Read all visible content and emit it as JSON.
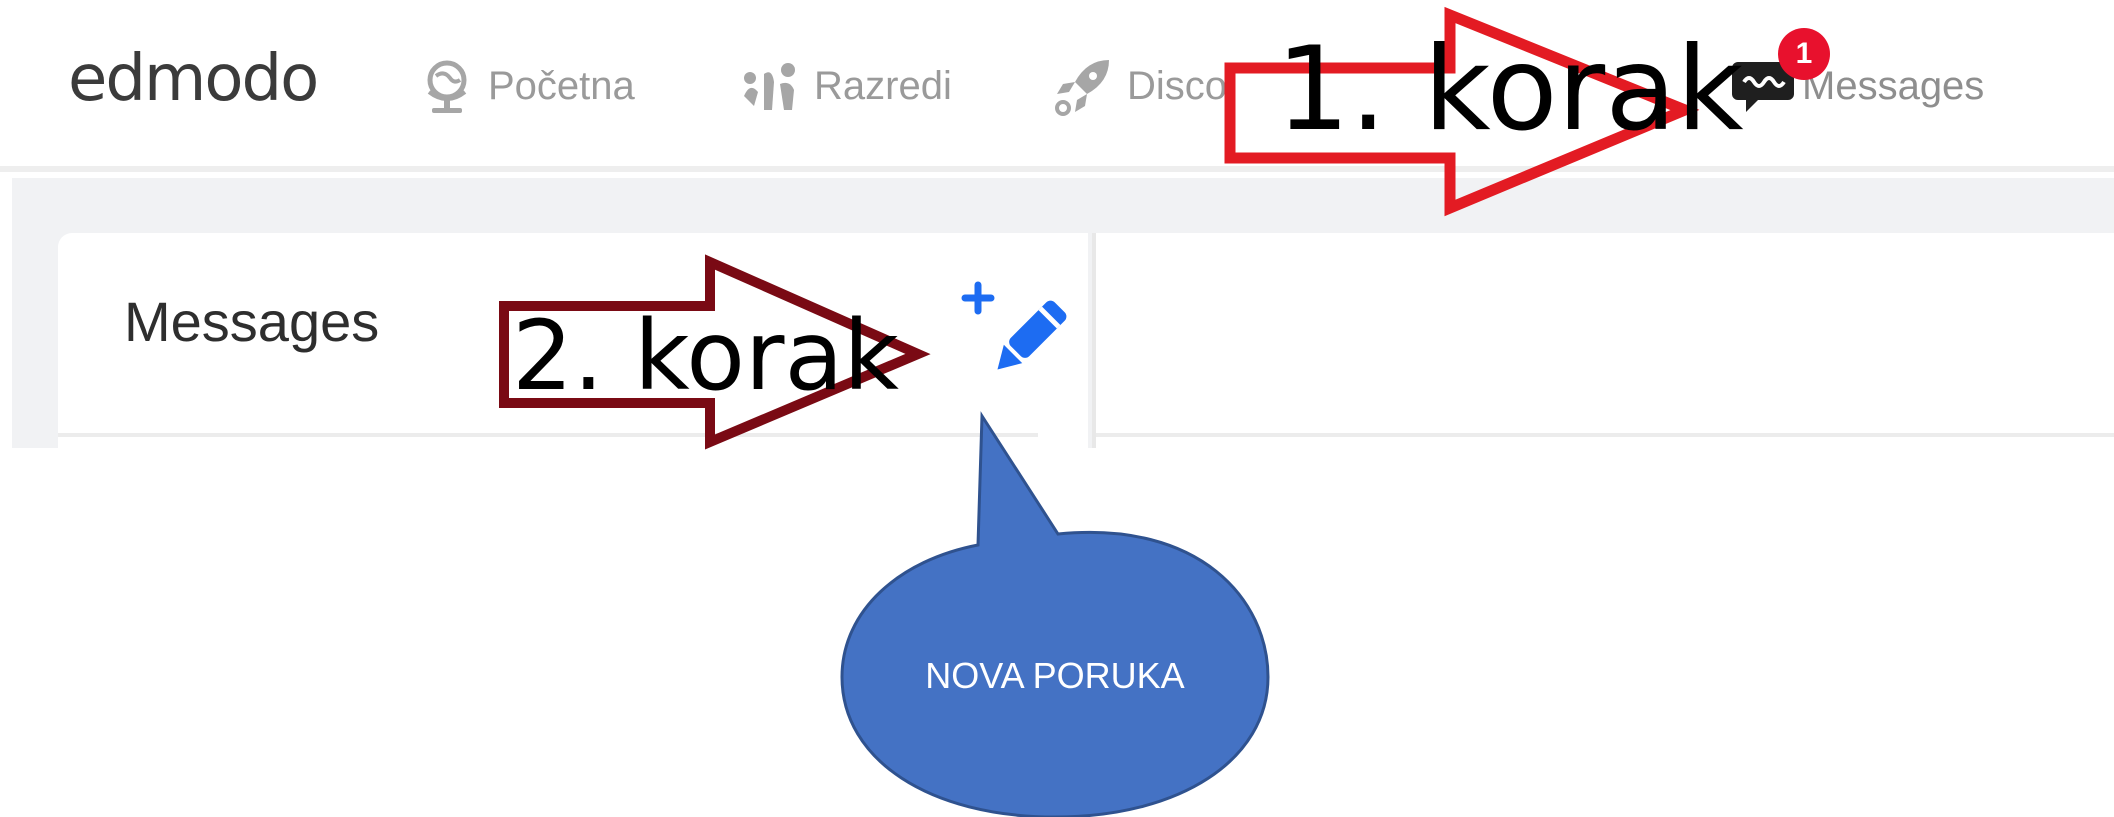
{
  "brand": {
    "logo": "edmodo"
  },
  "nav": {
    "home_label": "Početna",
    "classes_label": "Razredi",
    "discover_label": "Disco",
    "messages_label": "Messages",
    "messages_badge": "1"
  },
  "messages_panel": {
    "title": "Messages"
  },
  "annotations": {
    "step1": "1. korak",
    "step2": "2. korak",
    "callout": "NOVA PORUKA"
  },
  "colors": {
    "compose_icon": "#1d6cf2",
    "badge": "#e8112d",
    "step1_arrow": "#e31b23",
    "step2_arrow": "#7a0a14",
    "callout_fill": "#4472c4"
  },
  "icons": {
    "home": "globe-stand-icon",
    "classes": "people-icon",
    "discover": "rocket-icon",
    "messages": "chat-bubble-icon",
    "compose": "compose-pencil-plus-icon"
  }
}
